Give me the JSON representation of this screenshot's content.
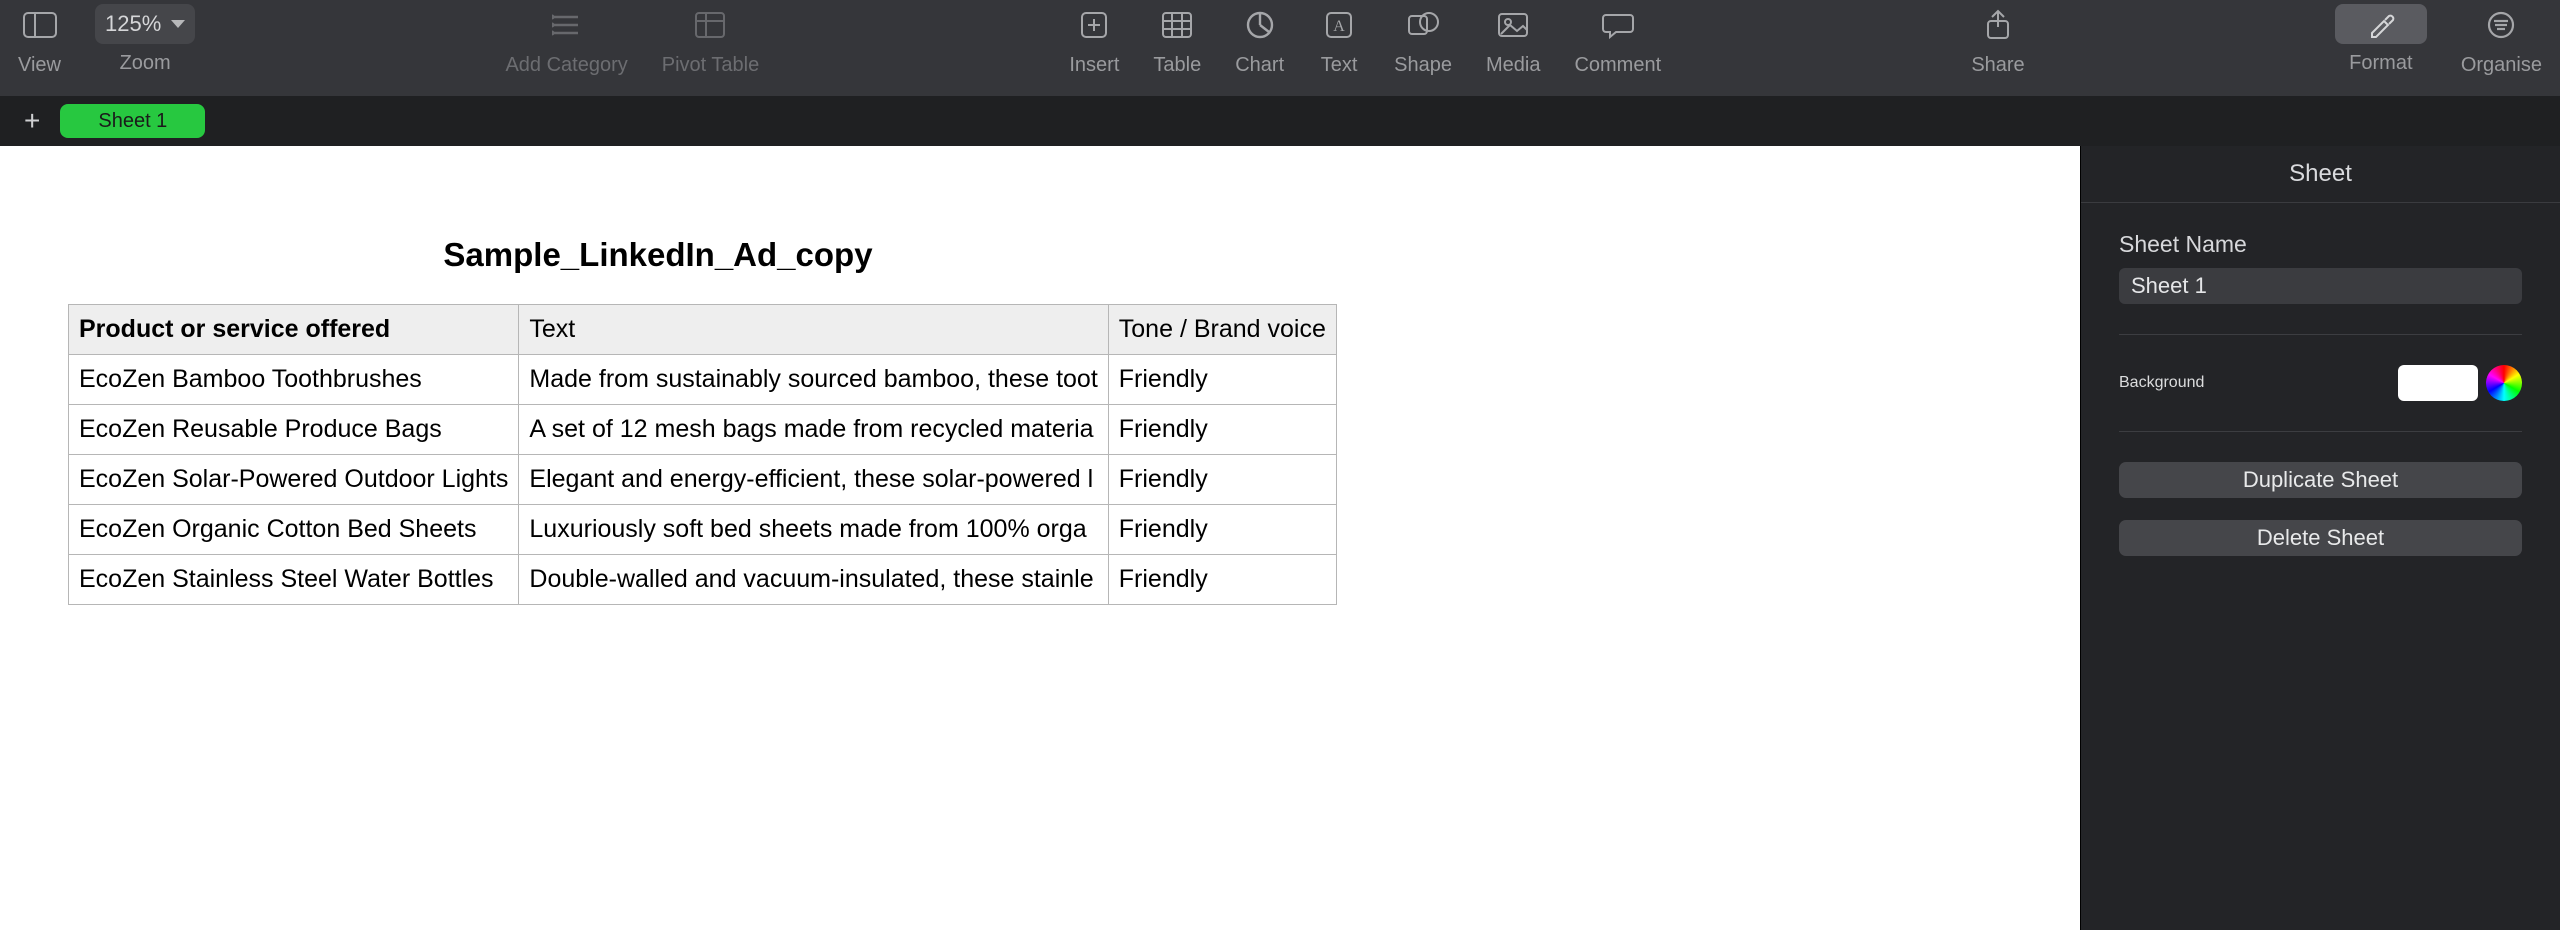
{
  "toolbar": {
    "view_label": "View",
    "zoom_label": "Zoom",
    "zoom_value": "125%",
    "add_category_label": "Add Category",
    "pivot_label": "Pivot Table",
    "insert_label": "Insert",
    "table_label": "Table",
    "chart_label": "Chart",
    "text_label": "Text",
    "shape_label": "Shape",
    "media_label": "Media",
    "comment_label": "Comment",
    "share_label": "Share",
    "format_label": "Format",
    "organise_label": "Organise"
  },
  "sheet_tab": "Sheet 1",
  "table": {
    "title": "Sample_LinkedIn_Ad_copy",
    "headers": {
      "a": "Product or service offered",
      "b": "Text",
      "c": "Tone / Brand voice"
    },
    "rows": [
      {
        "a": "EcoZen Bamboo Toothbrushes",
        "b": "Made from sustainably sourced bamboo, these toot",
        "c": "Friendly"
      },
      {
        "a": "EcoZen Reusable Produce Bags",
        "b": "A set of 12 mesh bags made from recycled materia",
        "c": "Friendly"
      },
      {
        "a": "EcoZen Solar-Powered Outdoor Lights",
        "b": "Elegant and energy-efficient, these solar-powered l",
        "c": "Friendly"
      },
      {
        "a": "EcoZen Organic Cotton Bed Sheets",
        "b": "Luxuriously soft bed sheets made from 100% orga",
        "c": "Friendly"
      },
      {
        "a": "EcoZen Stainless Steel Water Bottles",
        "b": "Double-walled and vacuum-insulated, these stainle",
        "c": "Friendly"
      }
    ]
  },
  "inspector": {
    "tab_label": "Sheet",
    "sheet_name_label": "Sheet Name",
    "sheet_name_value": "Sheet 1",
    "background_label": "Background",
    "duplicate_label": "Duplicate Sheet",
    "delete_label": "Delete Sheet"
  }
}
